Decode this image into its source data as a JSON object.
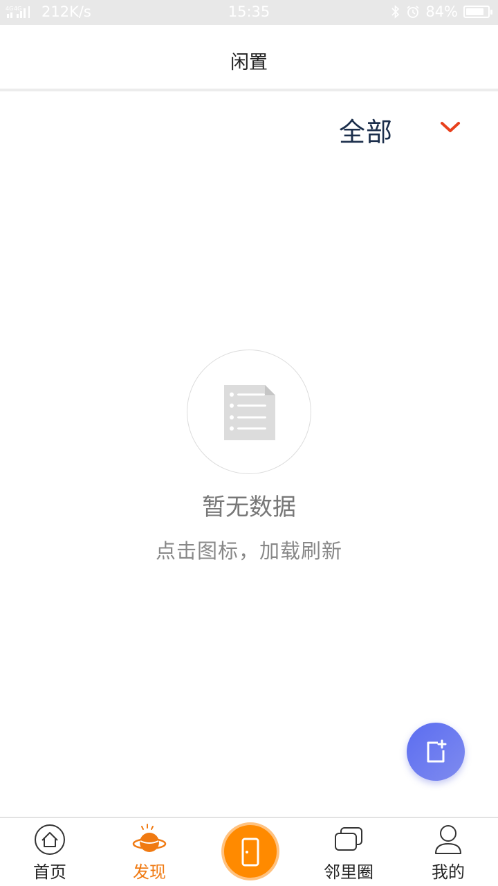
{
  "status_bar": {
    "network_speed": "212K/s",
    "time": "15:35",
    "battery": "84%",
    "battery_level": 0.84
  },
  "header": {
    "title": "闲置"
  },
  "filter": {
    "label": "全部",
    "icon": "chevron-down-icon",
    "icon_color": "#e8401c"
  },
  "empty_state": {
    "icon": "document-list-icon",
    "title": "暂无数据",
    "subtitle": "点击图标，加载刷新"
  },
  "fab": {
    "icon": "compose-icon",
    "color": "#6574ef"
  },
  "tabs": [
    {
      "label": "首页",
      "icon": "home-icon",
      "active": false
    },
    {
      "label": "发现",
      "icon": "planet-icon",
      "active": true
    },
    {
      "label": "",
      "icon": "door-icon",
      "active": false
    },
    {
      "label": "邻里圈",
      "icon": "cards-icon",
      "active": false
    },
    {
      "label": "我的",
      "icon": "user-icon",
      "active": false
    }
  ],
  "colors": {
    "accent": "#f07a12",
    "center_button": "#ff8a00"
  }
}
